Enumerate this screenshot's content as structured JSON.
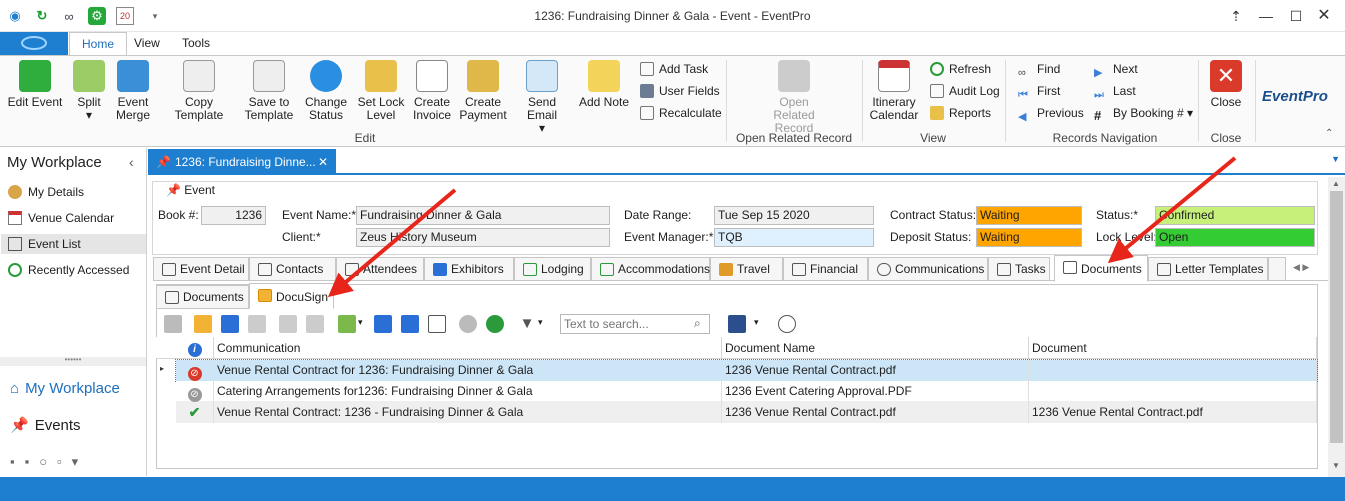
{
  "window": {
    "title": "1236: Fundraising Dinner & Gala - Event - EventPro"
  },
  "ribbon_tabs": [
    "Home",
    "View",
    "Tools"
  ],
  "ribbon": {
    "edit_buttons": [
      "Edit Event",
      "Split",
      "Event Merge",
      "Copy Template",
      "Save to Template",
      "Change Status",
      "Set Lock Level",
      "Create Invoice",
      "Create Payment",
      "Send Email",
      "Add Note"
    ],
    "edit_small": [
      "Add Task",
      "User Fields",
      "Recalculate"
    ],
    "edit_group": "Edit",
    "open_related": {
      "button": "Open Related Record",
      "group": "Open Related Record"
    },
    "view": {
      "button": "Itinerary Calendar",
      "small": [
        "Refresh",
        "Audit Log",
        "Reports"
      ],
      "group": "View"
    },
    "nav": {
      "col1": [
        "Find",
        "First",
        "Previous"
      ],
      "col2": [
        "Next",
        "Last",
        "By Booking #"
      ],
      "group": "Records Navigation"
    },
    "close": {
      "button": "Close",
      "group": "Close"
    },
    "logo": "EventPro"
  },
  "left_panel": {
    "title": "My Workplace",
    "items": [
      "My Details",
      "Venue Calendar",
      "Event List",
      "Recently Accessed"
    ],
    "bottom": [
      "My Workplace",
      "Events"
    ]
  },
  "doc_tab": {
    "label": "1236: Fundraising Dinne..."
  },
  "event": {
    "section": "Event",
    "book_label": "Book #:",
    "book": "1236",
    "name_label": "Event Name:*",
    "name": "Fundraising Dinner & Gala",
    "client_label": "Client:*",
    "client": "Zeus History Museum",
    "date_label": "Date Range:",
    "date": "Tue Sep 15 2020",
    "manager_label": "Event Manager:*",
    "manager": "TQB",
    "contract_label": "Contract Status:",
    "contract": "Waiting",
    "deposit_label": "Deposit Status:",
    "deposit": "Waiting",
    "status_label": "Status:*",
    "status": "Confirmed",
    "lock_label": "Lock Level:",
    "lock": "Open",
    "colors": {
      "waiting": "#ffa500",
      "confirmed": "#c6f07a",
      "open": "#33cc33"
    }
  },
  "tabs": [
    "Event Detail",
    "Contacts",
    "Attendees",
    "Exhibitors",
    "Lodging",
    "Accommodations",
    "Travel",
    "Financial",
    "Communications",
    "Tasks",
    "Documents",
    "Letter Templates"
  ],
  "subtabs": [
    "Documents",
    "DocuSign"
  ],
  "search": {
    "placeholder": "Text to search..."
  },
  "grid": {
    "columns": [
      "Communication",
      "Document Name",
      "Document"
    ],
    "rows": [
      {
        "status": "rejected",
        "communication": "Venue Rental Contract for 1236: Fundraising Dinner & Gala",
        "name": "1236 Venue Rental Contract.pdf",
        "document": ""
      },
      {
        "status": "cancelled",
        "communication": "Catering Arrangements for1236: Fundraising Dinner & Gala",
        "name": "1236 Event Catering Approval.PDF",
        "document": ""
      },
      {
        "status": "completed",
        "communication": "Venue Rental Contract:  1236 - Fundraising Dinner & Gala",
        "name": "1236 Venue Rental Contract.pdf",
        "document": "1236 Venue Rental Contract.pdf"
      }
    ]
  }
}
